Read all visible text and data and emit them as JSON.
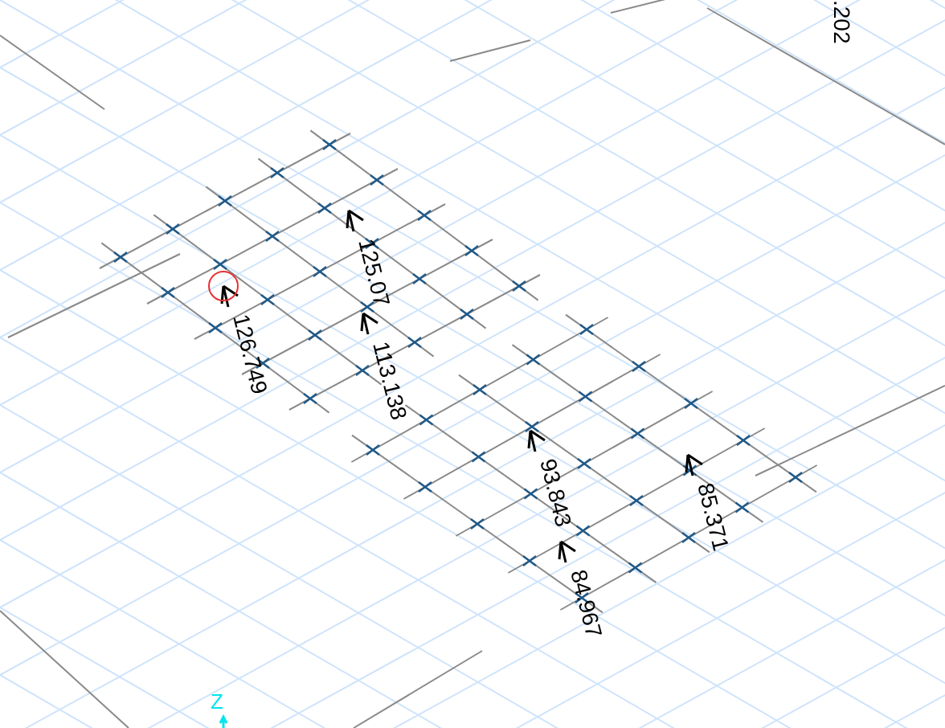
{
  "top_label": {
    "text": ".202"
  },
  "reactions": [
    {
      "value": "126.749",
      "selected": true
    },
    {
      "value": "125.07",
      "selected": false
    },
    {
      "value": "113.138",
      "selected": false
    },
    {
      "value": "93.843",
      "selected": false
    },
    {
      "value": "84.967",
      "selected": false
    },
    {
      "value": "85.371",
      "selected": false
    }
  ],
  "axis": {
    "label": "Z"
  }
}
